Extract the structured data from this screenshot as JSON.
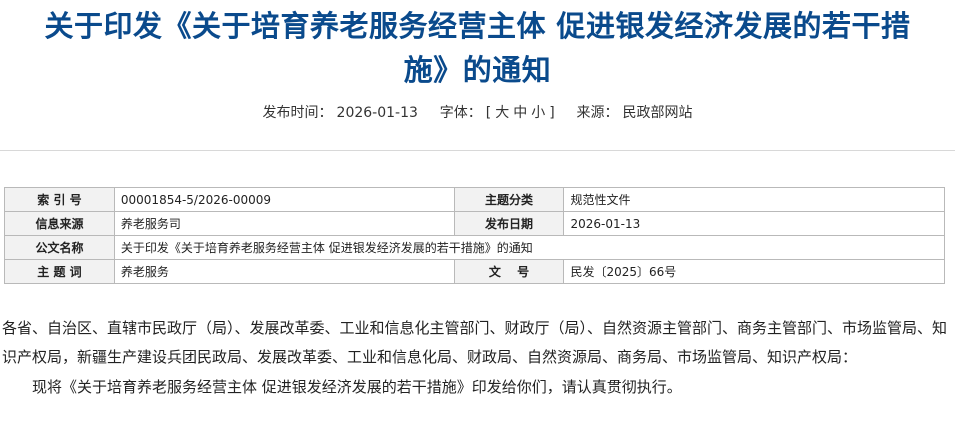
{
  "article": {
    "title_line1": "关于印发《关于培育养老服务经营主体 促进银发经济发展的若干措",
    "title_line2": "施》的通知"
  },
  "meta": {
    "publish_label": "发布时间：",
    "publish_date": "2026-01-13",
    "font_label": "字体：",
    "bracket_open": "[",
    "font_large": "大",
    "font_medium": "中",
    "font_small": "小",
    "bracket_close": "]",
    "source_label": "来源：",
    "source_value": "民政部网站"
  },
  "info_table": {
    "rows": [
      {
        "k1": "索 引 号",
        "v1": "00001854-5/2026-00009",
        "k2": "主题分类",
        "v2": "规范性文件"
      },
      {
        "k1": "信息来源",
        "v1": "养老服务司",
        "k2": "发布日期",
        "v2": "2026-01-13"
      },
      {
        "k1": "公文名称",
        "v1": "关于印发《关于培育养老服务经营主体 促进银发经济发展的若干措施》的通知"
      },
      {
        "k1": "主 题 词",
        "v1": "养老服务",
        "k2": "文　 号",
        "v2": "民发〔2025〕66号"
      }
    ]
  },
  "body": {
    "addressee": "各省、自治区、直辖市民政厅（局）、发展改革委、工业和信息化主管部门、财政厅（局）、自然资源主管部门、商务主管部门、市场监管局、知识产权局，新疆生产建设兵团民政局、发展改革委、工业和信息化局、财政局、自然资源局、商务局、市场监管局、知识产权局：",
    "paragraph1": "现将《关于培育养老服务经营主体 促进银发经济发展的若干措施》印发给你们，请认真贯彻执行。"
  }
}
